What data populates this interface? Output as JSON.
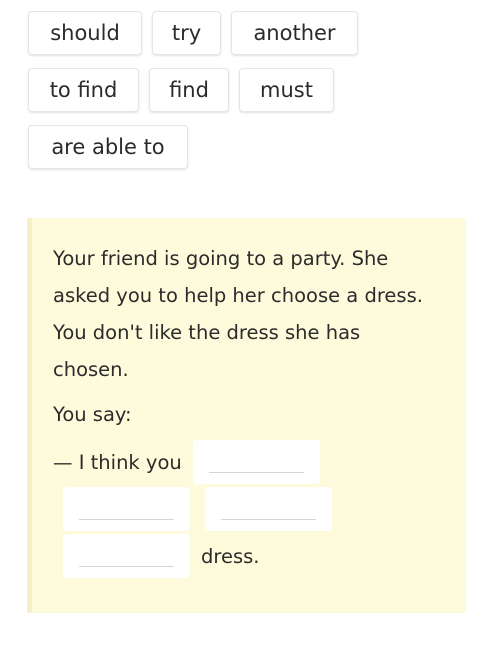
{
  "word_bank": {
    "rows": [
      [
        "should",
        "try",
        "another"
      ],
      [
        "to find",
        "find",
        "must"
      ],
      [
        "are able to"
      ]
    ]
  },
  "task": {
    "paragraph": "Your friend is going to a party. She asked you to help her choose a dress. You don't like the dress she has chosen.",
    "paragraph_lines": [
      "Your friend is going to a party. She",
      "asked you to help her choose a dress.",
      "You don't like the dress she has",
      "chosen."
    ],
    "you_say": "You say:",
    "sentence_start": "— I think you",
    "sentence_end": "dress.",
    "blanks": [
      {
        "value": "",
        "placeholder": ""
      },
      {
        "value": "",
        "placeholder": ""
      },
      {
        "value": "",
        "placeholder": ""
      },
      {
        "value": "",
        "placeholder": ""
      }
    ]
  },
  "colors": {
    "task_background": "#fefbdc",
    "task_border": "#f5f0c8",
    "text": "#2b2b2b"
  }
}
